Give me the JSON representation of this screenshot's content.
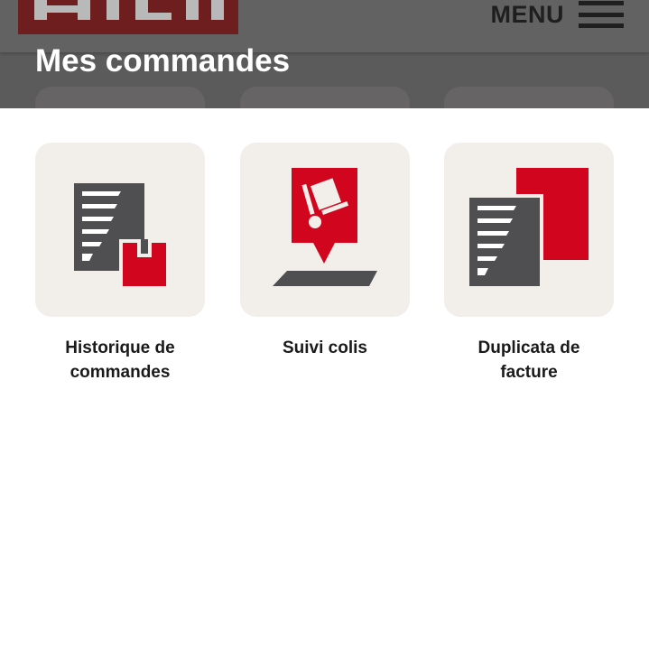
{
  "header": {
    "logo_text": "HILTI",
    "menu_label": "MENU",
    "page_title": "Mes commandes"
  },
  "tiles": [
    {
      "label": "Historique de\ncommandes",
      "icon": "order-history-icon"
    },
    {
      "label": "Suivi colis",
      "icon": "parcel-tracking-icon"
    },
    {
      "label": "Duplicata de\nfacture",
      "icon": "invoice-duplicate-icon"
    }
  ],
  "colors": {
    "brand_red": "#d2051e",
    "icon_gray": "#4f4e50",
    "tile_bg": "#f2efeb",
    "overlay_header": "#5b5b5b"
  }
}
